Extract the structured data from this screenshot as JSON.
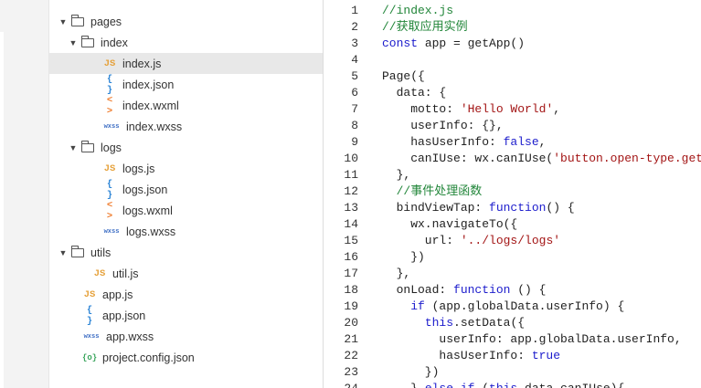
{
  "file_tree": [
    {
      "label": "pages",
      "kind": "folder",
      "caret": "▼",
      "depth": 0
    },
    {
      "label": "index",
      "kind": "folder",
      "caret": "▼",
      "depth": 1
    },
    {
      "label": "index.js",
      "kind": "js",
      "icon": "JS",
      "depth": 2,
      "selected": true
    },
    {
      "label": "index.json",
      "kind": "json",
      "icon": "{ }",
      "depth": 2
    },
    {
      "label": "index.wxml",
      "kind": "wxml",
      "icon": "< >",
      "depth": 2
    },
    {
      "label": "index.wxss",
      "kind": "wxss",
      "icon": "wxss",
      "depth": 2
    },
    {
      "label": "logs",
      "kind": "folder",
      "caret": "▼",
      "depth": 1
    },
    {
      "label": "logs.js",
      "kind": "js",
      "icon": "JS",
      "depth": 2
    },
    {
      "label": "logs.json",
      "kind": "json",
      "icon": "{ }",
      "depth": 2
    },
    {
      "label": "logs.wxml",
      "kind": "wxml",
      "icon": "< >",
      "depth": 2
    },
    {
      "label": "logs.wxss",
      "kind": "wxss",
      "icon": "wxss",
      "depth": 2
    },
    {
      "label": "utils",
      "kind": "folder",
      "caret": "▼",
      "depth": 0
    },
    {
      "label": "util.js",
      "kind": "js",
      "icon": "JS",
      "depth": 1
    },
    {
      "label": "app.js",
      "kind": "js",
      "icon": "JS",
      "depth": 0
    },
    {
      "label": "app.json",
      "kind": "json",
      "icon": "{ }",
      "depth": 0
    },
    {
      "label": "app.wxss",
      "kind": "wxss",
      "icon": "wxss",
      "depth": 0
    },
    {
      "label": "project.config.json",
      "kind": "config",
      "icon": "{o}",
      "depth": 0
    }
  ],
  "code_lines": [
    {
      "n": "1",
      "tokens": [
        [
          "c",
          "//index.js"
        ]
      ]
    },
    {
      "n": "2",
      "tokens": [
        [
          "c",
          "//获取应用实例"
        ]
      ]
    },
    {
      "n": "3",
      "tokens": [
        [
          "k",
          "const"
        ],
        [
          "p",
          " app = getApp()"
        ]
      ]
    },
    {
      "n": "4",
      "tokens": []
    },
    {
      "n": "5",
      "tokens": [
        [
          "p",
          "Page({"
        ]
      ]
    },
    {
      "n": "6",
      "tokens": [
        [
          "p",
          "  data: {"
        ]
      ]
    },
    {
      "n": "7",
      "tokens": [
        [
          "p",
          "    motto: "
        ],
        [
          "s",
          "'Hello World'"
        ],
        [
          "p",
          ","
        ]
      ]
    },
    {
      "n": "8",
      "tokens": [
        [
          "p",
          "    userInfo: {},"
        ]
      ]
    },
    {
      "n": "9",
      "tokens": [
        [
          "p",
          "    hasUserInfo: "
        ],
        [
          "k",
          "false"
        ],
        [
          "p",
          ","
        ]
      ]
    },
    {
      "n": "10",
      "tokens": [
        [
          "p",
          "    canIUse: wx.canIUse("
        ],
        [
          "s",
          "'button.open-type.getU"
        ]
      ]
    },
    {
      "n": "11",
      "tokens": [
        [
          "p",
          "  },"
        ]
      ]
    },
    {
      "n": "12",
      "tokens": [
        [
          "c",
          "  //事件处理函数"
        ]
      ]
    },
    {
      "n": "13",
      "tokens": [
        [
          "p",
          "  bindViewTap: "
        ],
        [
          "k",
          "function"
        ],
        [
          "p",
          "() {"
        ]
      ]
    },
    {
      "n": "14",
      "tokens": [
        [
          "p",
          "    wx.navigateTo({"
        ]
      ]
    },
    {
      "n": "15",
      "tokens": [
        [
          "p",
          "      url: "
        ],
        [
          "s",
          "'../logs/logs'"
        ]
      ]
    },
    {
      "n": "16",
      "tokens": [
        [
          "p",
          "    })"
        ]
      ]
    },
    {
      "n": "17",
      "tokens": [
        [
          "p",
          "  },"
        ]
      ]
    },
    {
      "n": "18",
      "tokens": [
        [
          "p",
          "  onLoad: "
        ],
        [
          "k",
          "function"
        ],
        [
          "p",
          " () {"
        ]
      ]
    },
    {
      "n": "19",
      "tokens": [
        [
          "p",
          "    "
        ],
        [
          "k",
          "if"
        ],
        [
          "p",
          " (app.globalData.userInfo) {"
        ]
      ]
    },
    {
      "n": "20",
      "tokens": [
        [
          "p",
          "      "
        ],
        [
          "k",
          "this"
        ],
        [
          "p",
          ".setData({"
        ]
      ]
    },
    {
      "n": "21",
      "tokens": [
        [
          "p",
          "        userInfo: app.globalData.userInfo,"
        ]
      ]
    },
    {
      "n": "22",
      "tokens": [
        [
          "p",
          "        hasUserInfo: "
        ],
        [
          "k",
          "true"
        ]
      ]
    },
    {
      "n": "23",
      "tokens": [
        [
          "p",
          "      })"
        ]
      ]
    },
    {
      "n": "24",
      "tokens": [
        [
          "p",
          "    } "
        ],
        [
          "k",
          "else if"
        ],
        [
          "p",
          " ("
        ],
        [
          "k",
          "this"
        ],
        [
          "p",
          ".data.canIUse){"
        ]
      ]
    }
  ]
}
